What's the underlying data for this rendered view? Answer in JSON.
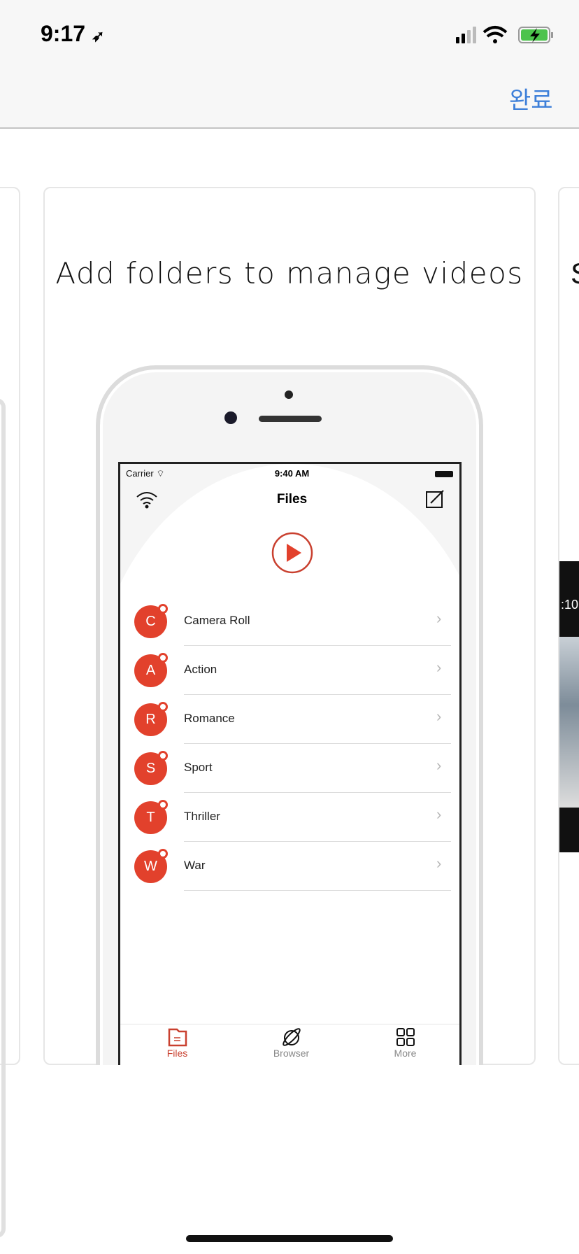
{
  "status_bar": {
    "time": "9:17",
    "icons": [
      "location-arrow-icon",
      "signal-icon",
      "wifi-icon",
      "battery-charging-icon"
    ],
    "battery_color": "#4cc34c"
  },
  "nav": {
    "done_label": "완료",
    "accent": "#3d7fd9"
  },
  "card": {
    "headline": "Add folders to manage videos",
    "next_headline_fragment": "S"
  },
  "mock_screen": {
    "carrier": "Carrier",
    "time": "9:40 AM",
    "title": "Files",
    "folders": [
      {
        "initial": "C",
        "name": "Camera Roll"
      },
      {
        "initial": "A",
        "name": "Action"
      },
      {
        "initial": "R",
        "name": "Romance"
      },
      {
        "initial": "S",
        "name": "Sport"
      },
      {
        "initial": "T",
        "name": "Thriller"
      },
      {
        "initial": "W",
        "name": "War"
      }
    ],
    "tabs": [
      {
        "label": "Files",
        "icon": "folder-icon",
        "active": true
      },
      {
        "label": "Browser",
        "icon": "browser-planet-icon"
      },
      {
        "label": "More",
        "icon": "grid-icon"
      }
    ],
    "accent": "#e2412c",
    "next_card_time_fragment": ":10:"
  }
}
